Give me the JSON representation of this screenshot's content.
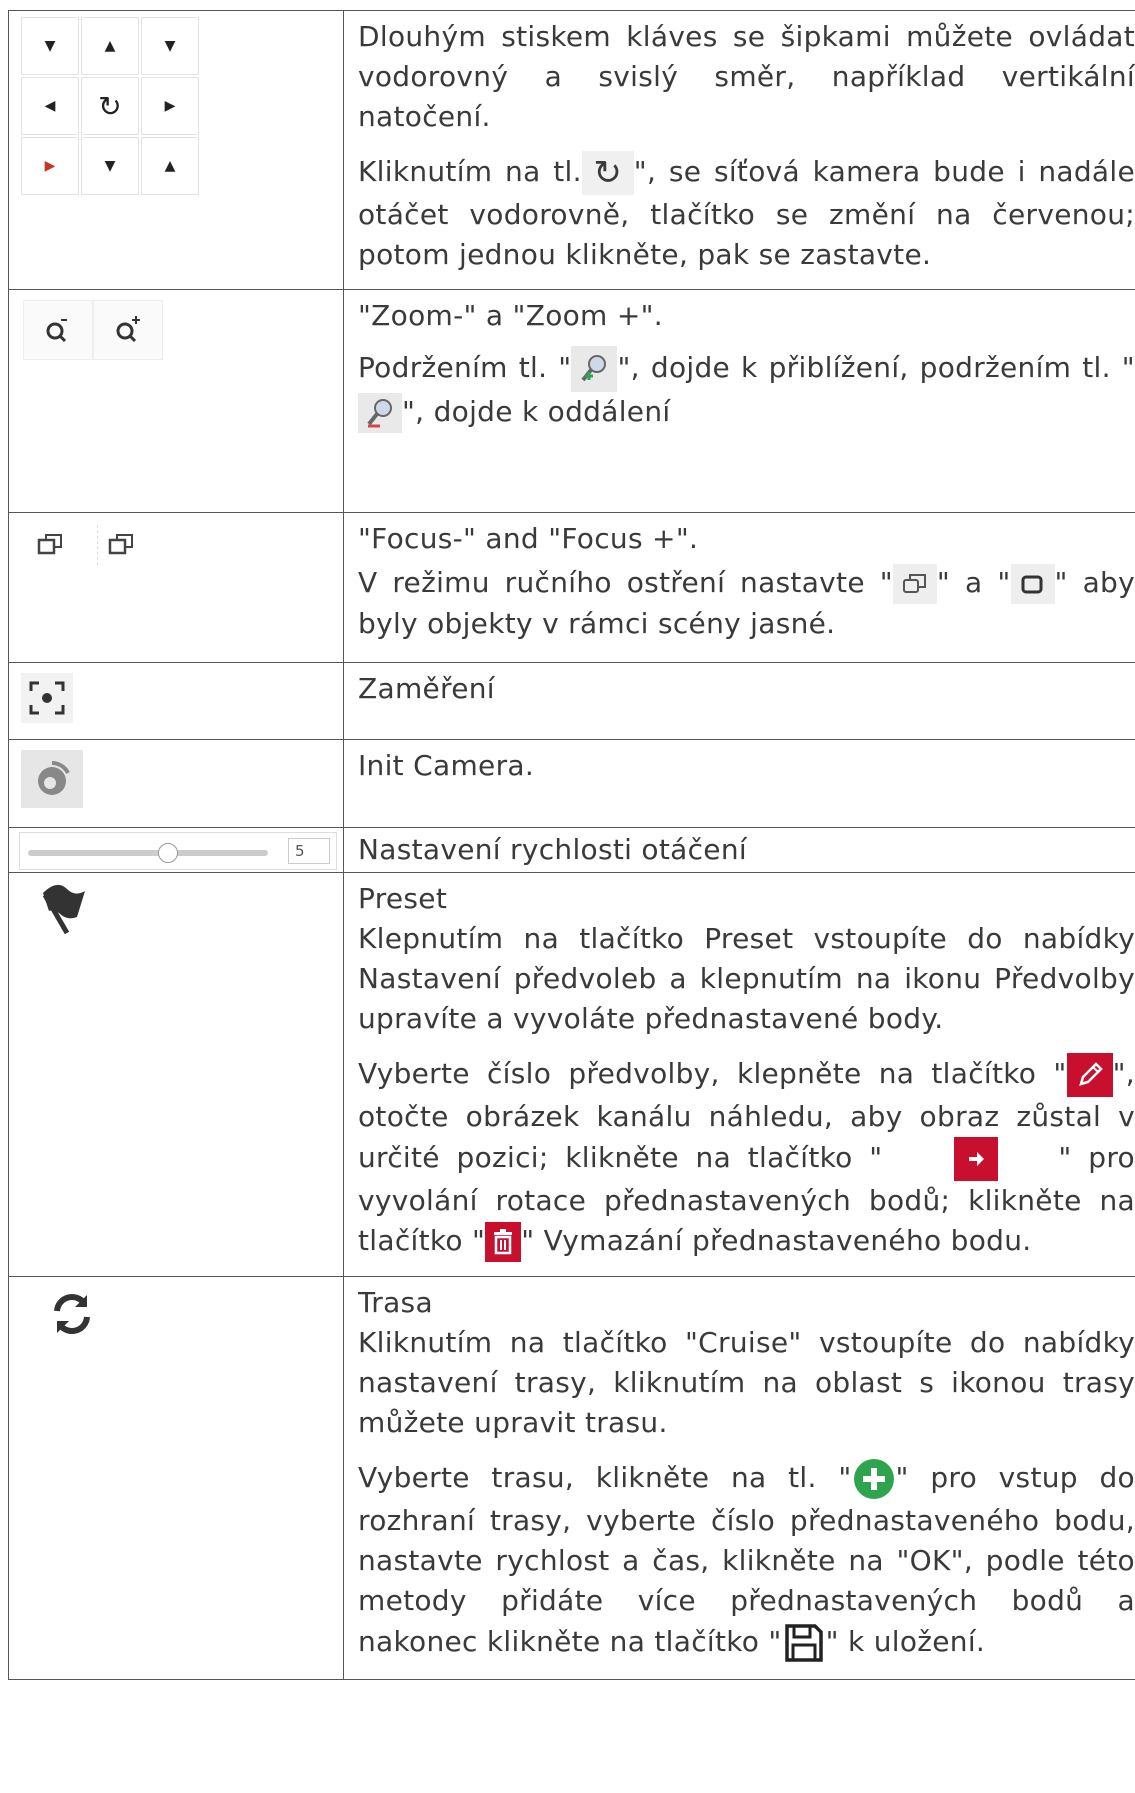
{
  "rows": [
    {
      "p1": "Dlouhým stiskem kláves se šipkami můžete ovládat vodorovný a svislý směr, například vertikální natočení.",
      "p2a": "Kliknutím na tl.",
      "p2b": "\", se síťová kamera bude i nadále otáčet vodorovně, tlačítko se změní na červenou; potom jednou klikněte, pak se zastavte."
    },
    {
      "title": "\"Zoom-\" a \"Zoom +\".",
      "p1a": "Podržením tl. \"",
      "p1b": "\", dojde k přiblížení, podržením tl. \"",
      "p1c": "\", dojde k oddálení"
    },
    {
      "title": "\"Focus-\" and \"Focus +\".",
      "p1a": "V režimu ručního ostření nastavte \"",
      "p1b": "\" a \"",
      "p1c": "\" aby byly objekty v rámci scény jasné."
    },
    {
      "title": "Zaměření"
    },
    {
      "title": "Init Camera."
    },
    {
      "title": "Nastavení rychlosti otáčení",
      "slider_value": "5",
      "slider_level": 0.58
    },
    {
      "title": "Preset",
      "p1": "Klepnutím na tlačítko Preset vstoupíte do nabídky Nastavení předvoleb a klepnutím na ikonu Předvolby upravíte a vyvoláte přednastavené body.",
      "p2a": "Vyberte číslo předvolby, klepněte na tlačítko \"",
      "p2b": "\", otočte obrázek kanálu náhledu, aby obraz zůstal v určité pozici; klikněte na tlačítko \"",
      "p2c": "\" pro vyvolání rotace přednastavených bodů; klikněte na tlačítko \"",
      "p2d": "\" Vymazání přednastaveného bodu."
    },
    {
      "title": "Trasa",
      "p1": "Kliknutím na tlačítko \"Cruise\" vstoupíte do nabídky nastavení trasy, kliknutím na oblast s ikonou trasy můžete upravit trasu.",
      "p2a": "Vyberte trasu, klikněte na tl. \"",
      "p2b": "\" pro vstup do rozhraní trasy, vyberte číslo přednastaveného bodu, nastavte rychlost a čas, klikněte na \"OK\", podle této metody přidáte více přednastavených bodů a nakonec klikněte na tlačítko \"",
      "p2c": "\" k uložení."
    }
  ],
  "colors": {
    "accent_red": "#c8102e",
    "add_green": "#2ea44f"
  }
}
